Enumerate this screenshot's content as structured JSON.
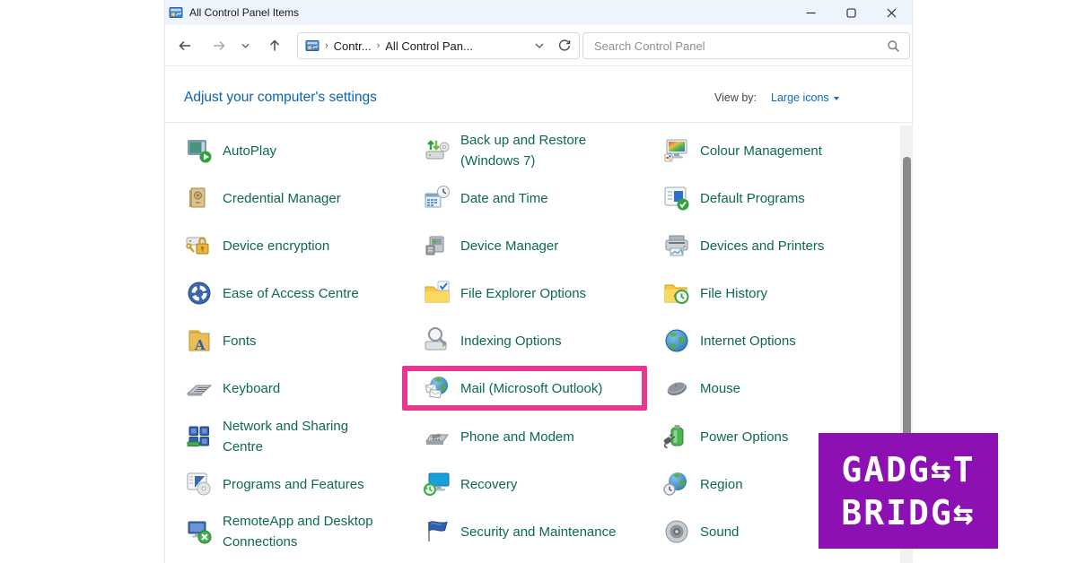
{
  "window": {
    "title": "All Control Panel Items"
  },
  "toolbar": {
    "breadcrumb": {
      "separator": "›",
      "root": "Contr...",
      "current": "All Control Pan..."
    },
    "search": {
      "placeholder": "Search Control Panel"
    }
  },
  "header": {
    "title": "Adjust your computer's settings",
    "view_by_label": "View by:",
    "view_by_value": "Large icons"
  },
  "items": [
    {
      "label": "AutoPlay",
      "icon": "autoplay"
    },
    {
      "label": "Back up and Restore (Windows 7)",
      "icon": "backup-restore"
    },
    {
      "label": "Colour Management",
      "icon": "colour-management"
    },
    {
      "label": "Credential Manager",
      "icon": "credential-manager"
    },
    {
      "label": "Date and Time",
      "icon": "date-time"
    },
    {
      "label": "Default Programs",
      "icon": "default-programs"
    },
    {
      "label": "Device encryption",
      "icon": "device-encryption"
    },
    {
      "label": "Device Manager",
      "icon": "device-manager"
    },
    {
      "label": "Devices and Printers",
      "icon": "devices-printers"
    },
    {
      "label": "Ease of Access Centre",
      "icon": "ease-of-access"
    },
    {
      "label": "File Explorer Options",
      "icon": "file-explorer-options"
    },
    {
      "label": "File History",
      "icon": "file-history"
    },
    {
      "label": "Fonts",
      "icon": "fonts"
    },
    {
      "label": "Indexing Options",
      "icon": "indexing-options"
    },
    {
      "label": "Internet Options",
      "icon": "internet-options"
    },
    {
      "label": "Keyboard",
      "icon": "keyboard"
    },
    {
      "label": "Mail (Microsoft Outlook)",
      "icon": "mail",
      "highlighted": true
    },
    {
      "label": "Mouse",
      "icon": "mouse"
    },
    {
      "label": "Network and Sharing Centre",
      "icon": "network-sharing"
    },
    {
      "label": "Phone and Modem",
      "icon": "phone-modem"
    },
    {
      "label": "Power Options",
      "icon": "power-options"
    },
    {
      "label": "Programs and Features",
      "icon": "programs-features"
    },
    {
      "label": "Recovery",
      "icon": "recovery"
    },
    {
      "label": "Region",
      "icon": "region"
    },
    {
      "label": "RemoteApp and Desktop Connections",
      "icon": "remoteapp"
    },
    {
      "label": "Security and Maintenance",
      "icon": "security-maintenance"
    },
    {
      "label": "Sound",
      "icon": "sound"
    }
  ],
  "logo": {
    "line1": "GADG⇆T",
    "line2": "BRIDG⇆"
  },
  "colors": {
    "header_blue": "#0a64ad",
    "link_blue": "#0a6cc0",
    "item_text_green": "#0c6b47",
    "highlight_pink": "#e9368f",
    "logo_purple": "#8d10b2",
    "titlebar_bg": "#eef4fb"
  }
}
